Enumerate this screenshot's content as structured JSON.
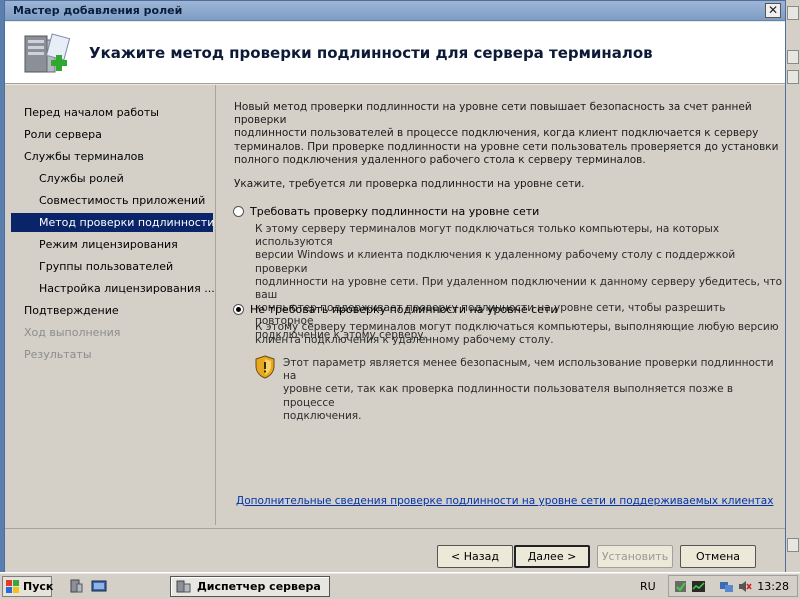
{
  "window": {
    "title": "Мастер добавления ролей",
    "heading": "Укажите метод проверки подлинности для сервера терминалов"
  },
  "nav": {
    "items": [
      {
        "label": "Перед началом работы",
        "level": 0,
        "state": "normal"
      },
      {
        "label": "Роли сервера",
        "level": 0,
        "state": "normal"
      },
      {
        "label": "Службы терминалов",
        "level": 0,
        "state": "normal"
      },
      {
        "label": "Службы ролей",
        "level": 1,
        "state": "normal"
      },
      {
        "label": "Совместимость приложений",
        "level": 1,
        "state": "normal"
      },
      {
        "label": "Метод проверки подлинности",
        "level": 1,
        "state": "selected"
      },
      {
        "label": "Режим лицензирования",
        "level": 1,
        "state": "normal"
      },
      {
        "label": "Группы пользователей",
        "level": 1,
        "state": "normal"
      },
      {
        "label": "Настройка лицензирования ...",
        "level": 1,
        "state": "normal"
      },
      {
        "label": "Подтверждение",
        "level": 0,
        "state": "normal"
      },
      {
        "label": "Ход выполнения",
        "level": 0,
        "state": "disabled"
      },
      {
        "label": "Результаты",
        "level": 0,
        "state": "disabled"
      }
    ]
  },
  "content": {
    "intro_lines": [
      "Новый метод проверки подлинности на уровне сети повышает безопасность за счет ранней проверки",
      "подлинности пользователей в процессе подключения, когда клиент подключается к серверу",
      "терминалов. При проверке подлинности на уровне сети пользователь проверяется до установки",
      "полного подключения удаленного рабочего стола к серверу терминалов."
    ],
    "question": "Укажите, требуется ли проверка подлинности на уровне сети.",
    "options": [
      {
        "label": "Требовать проверку подлинности на уровне сети",
        "selected": false,
        "desc_lines": [
          "К этому серверу терминалов могут подключаться только компьютеры, на которых используются",
          "версии Windows и клиента подключения к удаленному рабочему столу с поддержкой проверки",
          "подлинности на уровне сети. При удаленном подключении к данному серверу убедитесь, что ваш",
          "компьютер поддерживает проверку подлинности на уровне сети, чтобы разрешить повторное",
          "подключение к этому серверу."
        ]
      },
      {
        "label": "Не требовать проверку подлинности на уровне сети",
        "selected": true,
        "desc_lines": [
          "К этому серверу терминалов могут подключаться компьютеры, выполняющие любую версию",
          "клиента подключения к удаленному рабочему столу."
        ]
      }
    ],
    "warning_lines": [
      "Этот параметр является менее безопасным, чем использование проверки подлинности на",
      "уровне сети, так как проверка подлинности пользователя выполняется позже в процессе",
      "подключения."
    ],
    "link": "Дополнительные сведения проверке подлинности на уровне сети и поддерживаемых клиентах"
  },
  "buttons": {
    "back": "< Назад",
    "next": "Далее >",
    "install": "Установить",
    "cancel": "Отмена"
  },
  "taskbar": {
    "start": "Пуск",
    "task": "Диспетчер сервера",
    "lang": "RU",
    "time": "13:28"
  },
  "colors": {
    "selection": "#0a246a",
    "link": "#0033aa",
    "window_border": "#4f6f9a"
  }
}
